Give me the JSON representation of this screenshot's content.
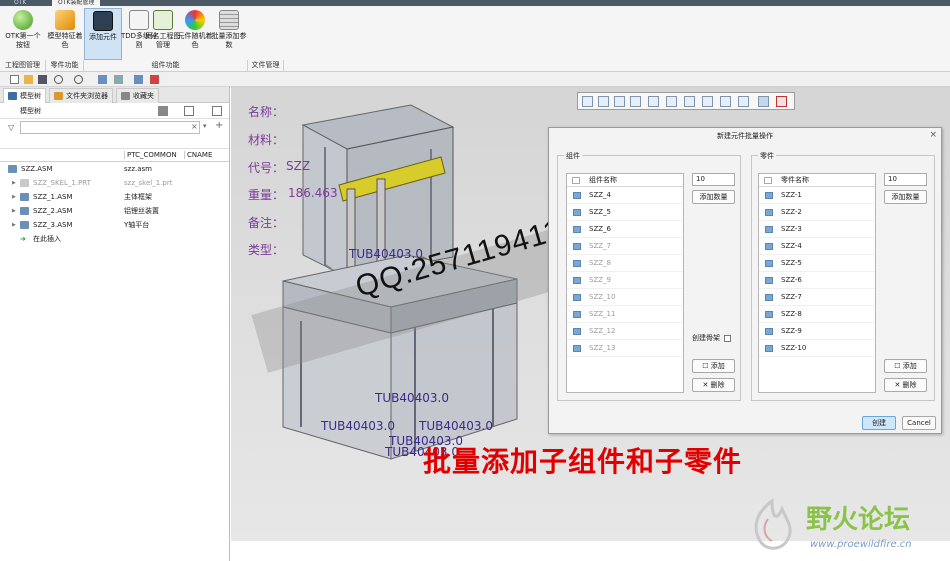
{
  "top_tabs": [
    "OTK",
    "OTK装配管理"
  ],
  "ribbon": {
    "buttons": [
      {
        "label": "OTK第一个按钮",
        "icon": "green-ball-icon"
      },
      {
        "label": "模型特征着色",
        "icon": "cube-orange-icon"
      },
      {
        "label": "添加元件",
        "icon": "terminal-icon",
        "selected": true
      },
      {
        "label": "TDD多级分割",
        "icon": "document-icon"
      },
      {
        "label": "同名工程图管理",
        "icon": "drawing-icon"
      },
      {
        "label": "元件随机着色",
        "icon": "palette-icon"
      },
      {
        "label": "批量添加参数",
        "icon": "table-icon"
      }
    ],
    "groups": [
      "工程图管理",
      "零件功能",
      "组件功能",
      "文件管理"
    ]
  },
  "left_panel": {
    "tabs": [
      "模型树",
      "文件夹浏览器",
      "收藏夹"
    ],
    "tree_label": "模型树",
    "columns": [
      "PTC_COMMON",
      "CNAME"
    ],
    "rows": [
      {
        "name": "SZZ.ASM",
        "common": "szz.asm",
        "dim": false
      },
      {
        "name": "SZZ_SKEL_1.PRT",
        "common": "szz_skel_1.prt",
        "dim": true
      },
      {
        "name": "SZZ_1.ASM",
        "common": "主体框架",
        "dim": false
      },
      {
        "name": "SZZ_2.ASM",
        "common": "铝锂丝装置",
        "dim": false
      },
      {
        "name": "SZZ_3.ASM",
        "common": "Y轴平台",
        "dim": false
      }
    ],
    "insert_label": "在此插入"
  },
  "graphics": {
    "params": [
      "名称：",
      "材料：",
      "代号：",
      "重量：",
      "备注：",
      "类型："
    ],
    "code_value": "SZZ",
    "weight_value": "186.463",
    "tube_labels": [
      "TUB40403.0",
      "TUB40403.0",
      "TUB40403.0",
      "TUB40403.0",
      "TUB40403.0",
      "TUB40403.0"
    ]
  },
  "dialog": {
    "title": "新建元件批量操作",
    "left": {
      "title": "组件",
      "header": "组件名称",
      "items": [
        "SZZ_4",
        "SZZ_5",
        "SZZ_6",
        "SZZ_7",
        "SZZ_8",
        "SZZ_9",
        "SZZ_10",
        "SZZ_11",
        "SZZ_12",
        "SZZ_13"
      ],
      "dim_from": 3,
      "count": "10",
      "add_count": "添加数量",
      "create_skeleton": "创建骨架",
      "add": "添加",
      "delete": "删除"
    },
    "right": {
      "title": "零件",
      "header": "零件名称",
      "items": [
        "SZZ-1",
        "SZZ-2",
        "SZZ-3",
        "SZZ-4",
        "SZZ-5",
        "SZZ-6",
        "SZZ-7",
        "SZZ-8",
        "SZZ-9",
        "SZZ-10"
      ],
      "count": "10",
      "add_count": "添加数量",
      "add": "添加",
      "delete": "删除"
    },
    "create": "创建",
    "cancel": "Cancel"
  },
  "watermark": {
    "qq": "QQ:2571194117",
    "caption": "批量添加子组件和子零件",
    "logo": "野火论坛",
    "url": "www.proewildfire.cn"
  },
  "colors": {
    "caption": "#e00000",
    "param": "#7a3c9a",
    "logo": "#8bc34a"
  }
}
